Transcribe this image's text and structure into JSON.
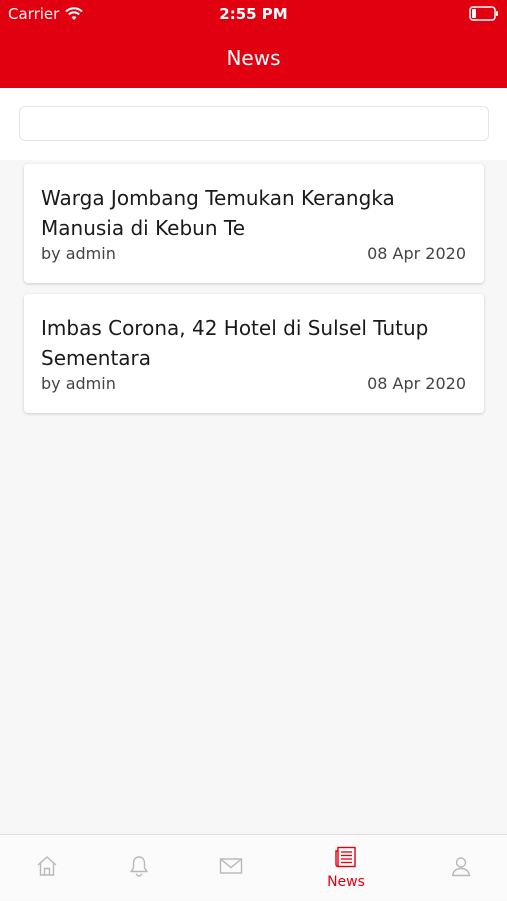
{
  "status_bar": {
    "carrier": "Carrier",
    "time": "2:55 PM"
  },
  "header": {
    "title": "News"
  },
  "search": {
    "value": ""
  },
  "news": [
    {
      "title": "Warga Jombang Temukan Kerangka Manusia di Kebun Te",
      "author": "by admin",
      "date": "08 Apr 2020"
    },
    {
      "title": "Imbas Corona, 42 Hotel di Sulsel Tutup Sementara",
      "author": "by admin",
      "date": "08 Apr 2020"
    }
  ],
  "tabbar": {
    "tabs": [
      {
        "icon": "home-icon",
        "label": ""
      },
      {
        "icon": "bell-icon",
        "label": ""
      },
      {
        "icon": "mail-icon",
        "label": ""
      },
      {
        "icon": "news-icon",
        "label": "News",
        "active": true
      },
      {
        "icon": "user-icon",
        "label": ""
      }
    ]
  },
  "colors": {
    "brand": "#e10010",
    "inactive_icon": "#b8b8b8"
  }
}
